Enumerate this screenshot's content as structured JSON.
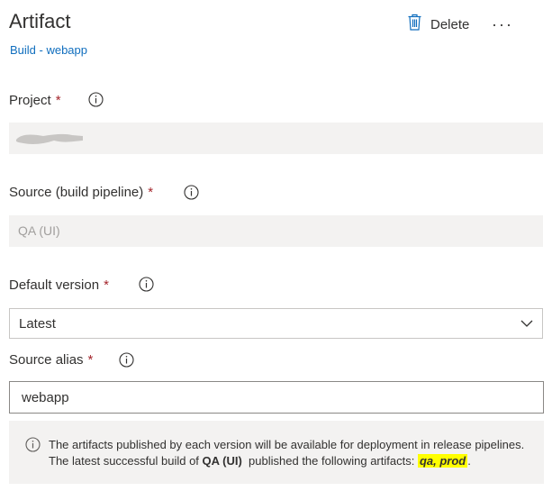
{
  "header": {
    "title": "Artifact",
    "subtitle": "Build - webapp",
    "delete_label": "Delete",
    "more_label": "···"
  },
  "fields": {
    "project": {
      "label": "Project",
      "required": "*",
      "value": ""
    },
    "source": {
      "label": "Source (build pipeline)",
      "required": "*",
      "value": "QA (UI)"
    },
    "default_version": {
      "label": "Default version",
      "required": "*",
      "value": "Latest"
    },
    "source_alias": {
      "label": "Source alias",
      "required": "*",
      "value": "webapp"
    }
  },
  "note": {
    "line1": "The artifacts published by each version will be available for deployment in release pipelines.",
    "line2_prefix": "The latest successful build of ",
    "line2_pipeline": "QA (UI)",
    "line2_middle": "  published the following artifacts: ",
    "line2_artifacts": "qa, prod",
    "line2_suffix": "."
  },
  "icons": {
    "delete": "trash-icon",
    "info": "info-icon",
    "dropdown": "chevron-down-icon",
    "more": "more-icon"
  },
  "colors": {
    "link": "#106ebe",
    "required": "#a4262c",
    "field_bg": "#f3f2f1",
    "highlight": "#ffff00"
  }
}
